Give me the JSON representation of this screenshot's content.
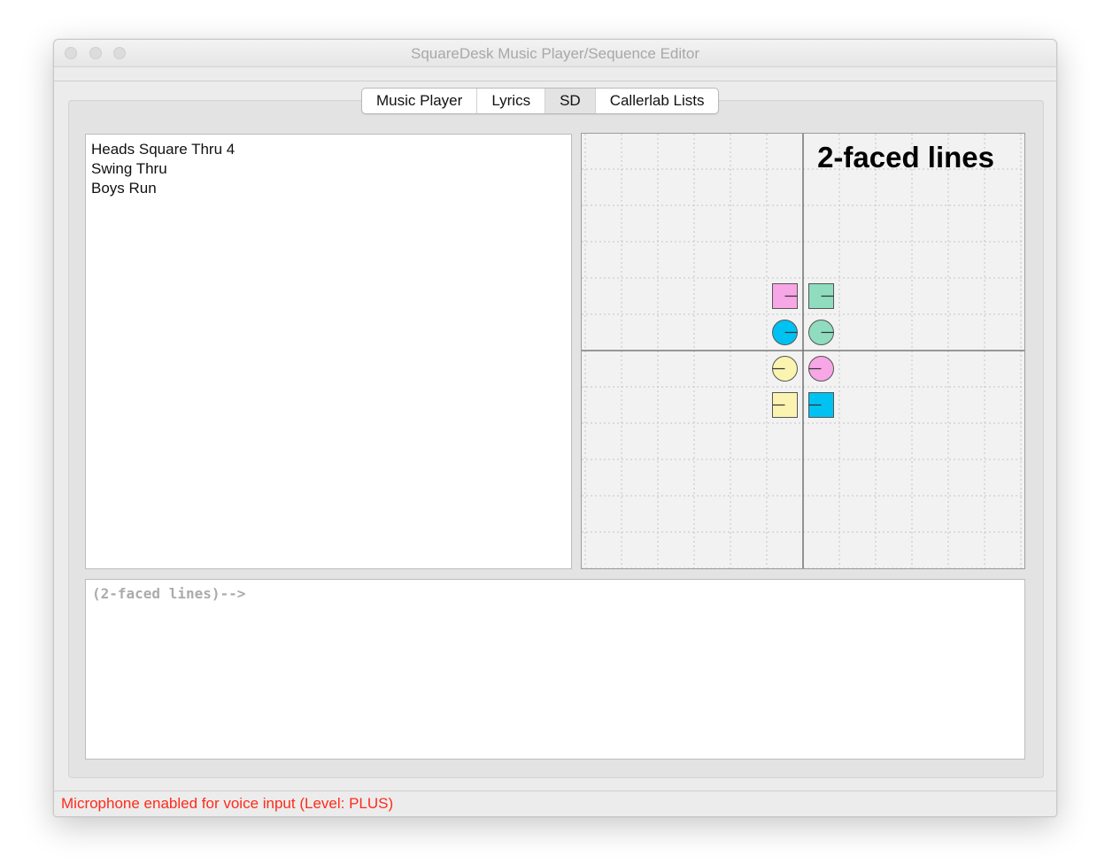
{
  "window": {
    "title": "SquareDesk Music Player/Sequence Editor"
  },
  "tabs": [
    {
      "label": "Music Player",
      "active": false
    },
    {
      "label": "Lyrics",
      "active": false
    },
    {
      "label": "SD",
      "active": true
    },
    {
      "label": "Callerlab Lists",
      "active": false
    }
  ],
  "sequence": {
    "calls": [
      "Heads Square Thru 4",
      "Swing Thru",
      "Boys Run"
    ]
  },
  "formation": {
    "title": "2-faced lines",
    "dancers": [
      {
        "shape": "square",
        "color": "#f7a6e6",
        "facing": "right"
      },
      {
        "shape": "square",
        "color": "#8fdcbf",
        "facing": "right"
      },
      {
        "shape": "circle",
        "color": "#00c2f2",
        "facing": "right"
      },
      {
        "shape": "circle",
        "color": "#8fdcbf",
        "facing": "right"
      },
      {
        "shape": "circle",
        "color": "#fbf4b0",
        "facing": "left"
      },
      {
        "shape": "circle",
        "color": "#f7a6e6",
        "facing": "left"
      },
      {
        "shape": "square",
        "color": "#fbf4b0",
        "facing": "left"
      },
      {
        "shape": "square",
        "color": "#00c2f2",
        "facing": "left"
      }
    ]
  },
  "command": {
    "placeholder": "(2-faced lines)-->",
    "value": ""
  },
  "status": {
    "text": "Microphone enabled for voice input (Level: PLUS)",
    "color": "#ff2a1a"
  },
  "colors": {
    "window_bg": "#ececec",
    "pane_bg": "#e3e3e3",
    "diagram_bg": "#f2f2f2",
    "traffic_light": "#dcdcdc"
  },
  "icons": {
    "traffic_lights": [
      "close-icon",
      "minimize-icon",
      "zoom-icon"
    ]
  }
}
